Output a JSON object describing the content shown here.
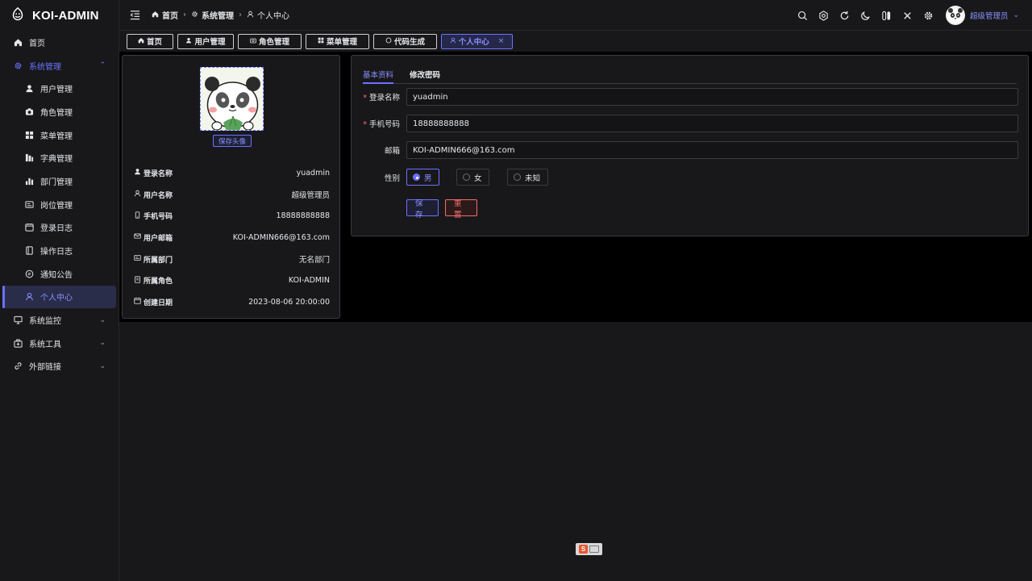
{
  "app": {
    "title": "KOI-ADMIN"
  },
  "sidebar": {
    "items": [
      {
        "label": "首页",
        "icon": "home-icon"
      },
      {
        "label": "系统管理",
        "icon": "gear-icon",
        "expanded": true
      },
      {
        "label": "用户管理",
        "icon": "user-icon"
      },
      {
        "label": "角色管理",
        "icon": "camera-icon"
      },
      {
        "label": "菜单管理",
        "icon": "grid-icon"
      },
      {
        "label": "字典管理",
        "icon": "dictionary-icon"
      },
      {
        "label": "部门管理",
        "icon": "bar-chart-icon"
      },
      {
        "label": "岗位管理",
        "icon": "id-card-icon"
      },
      {
        "label": "登录日志",
        "icon": "calendar-icon"
      },
      {
        "label": "操作日志",
        "icon": "book-icon"
      },
      {
        "label": "通知公告",
        "icon": "chat-icon"
      },
      {
        "label": "个人中心",
        "icon": "user-outline-icon",
        "active": true
      },
      {
        "label": "系统监控",
        "icon": "monitor-icon"
      },
      {
        "label": "系统工具",
        "icon": "toolbox-icon"
      },
      {
        "label": "外部链接",
        "icon": "link-icon"
      }
    ]
  },
  "breadcrumb": [
    {
      "label": "首页",
      "icon": "home-icon"
    },
    {
      "label": "系统管理",
      "icon": "gear-icon"
    },
    {
      "label": "个人中心",
      "icon": "user-outline-icon"
    }
  ],
  "header": {
    "user_name": "超级管理员",
    "tools": [
      "search-icon",
      "theme-icon",
      "refresh-icon",
      "moon-icon",
      "switch-icon",
      "close-icon",
      "settings-icon"
    ]
  },
  "tabs": [
    {
      "label": "首页",
      "icon": "home-icon"
    },
    {
      "label": "用户管理",
      "icon": "user-icon"
    },
    {
      "label": "角色管理",
      "icon": "camera-icon"
    },
    {
      "label": "菜单管理",
      "icon": "grid-icon"
    },
    {
      "label": "代码生成",
      "icon": "circle-icon"
    },
    {
      "label": "个人中心",
      "icon": "user-outline-icon",
      "active": true,
      "closable": true,
      "close": "×"
    }
  ],
  "profile": {
    "save_avatar": "保存头像",
    "info": [
      {
        "key": "登录名称",
        "value": "yuadmin",
        "icon": "user-icon"
      },
      {
        "key": "用户名称",
        "value": "超级管理员",
        "icon": "user-outline-icon"
      },
      {
        "key": "手机号码",
        "value": "18888888888",
        "icon": "phone-icon"
      },
      {
        "key": "用户邮箱",
        "value": "KOI-ADMIN666@163.com",
        "icon": "mail-icon"
      },
      {
        "key": "所属部门",
        "value": "无名部门",
        "icon": "id-card-icon"
      },
      {
        "key": "所属角色",
        "value": "KOI-ADMIN",
        "icon": "badge-icon"
      },
      {
        "key": "创建日期",
        "value": "2023-08-06 20:00:00",
        "icon": "calendar-icon"
      }
    ]
  },
  "form": {
    "tabs": [
      "基本资料",
      "修改密码"
    ],
    "login_name": {
      "label": "登录名称",
      "value": "yuadmin",
      "required_mark": "*"
    },
    "phone": {
      "label": "手机号码",
      "value": "18888888888",
      "required_mark": "*"
    },
    "email": {
      "label": "邮箱",
      "value": "KOI-ADMIN666@163.com"
    },
    "gender": {
      "label": "性别",
      "options": [
        "男",
        "女",
        "未知"
      ],
      "selected": "男"
    },
    "save_label": "保存",
    "reset_label": "重置"
  },
  "colors": {
    "accent": "#6b72ff",
    "danger": "#f56c6c",
    "background": "#18181a"
  }
}
